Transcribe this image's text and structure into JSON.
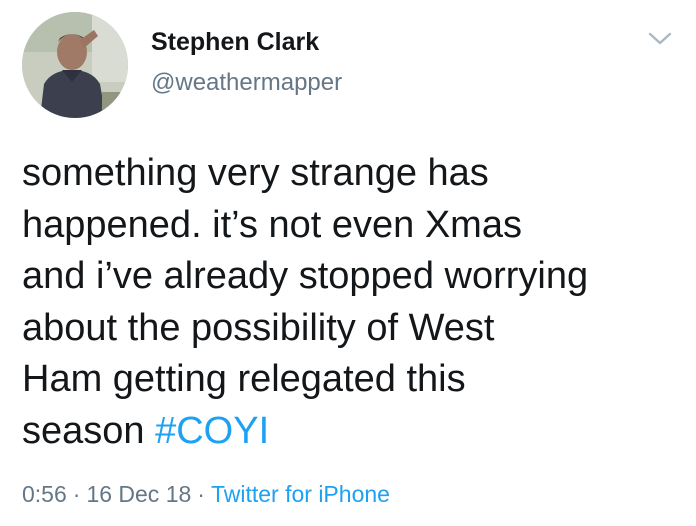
{
  "author": {
    "display_name": "Stephen Clark",
    "handle": "@weathermapper"
  },
  "tweet": {
    "lines": [
      "something very strange has",
      "happened. it’s not even Xmas",
      "and i’ve already stopped worrying",
      "about the possibility of West",
      "Ham getting relegated this"
    ],
    "last_line_text": "season ",
    "hashtag": "#COYI"
  },
  "meta": {
    "time": "0:56",
    "separator": "·",
    "date": "16 Dec 18",
    "source": "Twitter for iPhone"
  },
  "icons": {
    "menu": "chevron-down-icon"
  },
  "colors": {
    "text": "#14171a",
    "secondary": "#657786",
    "link": "#1da1f2"
  }
}
